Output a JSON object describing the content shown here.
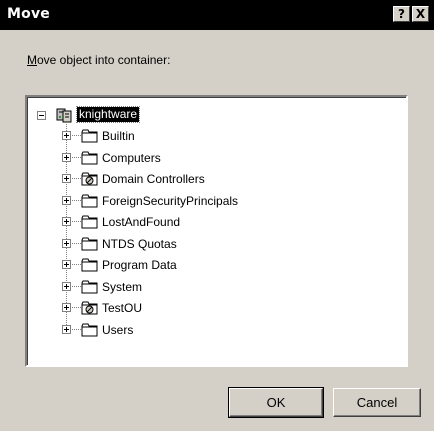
{
  "window": {
    "title": "Move",
    "help_glyph": "?",
    "close_glyph": "X"
  },
  "prompt": {
    "accel": "M",
    "rest": "ove object into container:"
  },
  "tree": {
    "root": {
      "label": "knightware",
      "icon": "domain-icon",
      "expanded": true,
      "selected": true
    },
    "children": [
      {
        "label": "Builtin",
        "icon": "folder-icon"
      },
      {
        "label": "Computers",
        "icon": "folder-icon"
      },
      {
        "label": "Domain Controllers",
        "icon": "ou-icon"
      },
      {
        "label": "ForeignSecurityPrincipals",
        "icon": "folder-icon"
      },
      {
        "label": "LostAndFound",
        "icon": "folder-icon"
      },
      {
        "label": "NTDS Quotas",
        "icon": "folder-icon"
      },
      {
        "label": "Program Data",
        "icon": "folder-icon"
      },
      {
        "label": "System",
        "icon": "folder-icon"
      },
      {
        "label": "TestOU",
        "icon": "ou-icon"
      },
      {
        "label": "Users",
        "icon": "folder-icon"
      }
    ]
  },
  "buttons": {
    "ok": "OK",
    "cancel": "Cancel"
  }
}
